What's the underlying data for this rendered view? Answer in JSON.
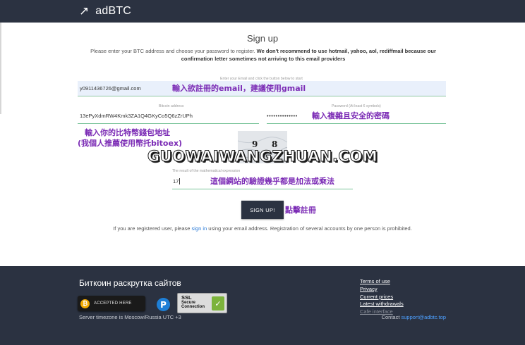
{
  "header": {
    "logo_icon": "arrow-up-right-icon",
    "logo_text": "adBTC",
    "bg_color": "#2b3241"
  },
  "form": {
    "title": "Sign up",
    "intro_normal": "Please enter your BTC address and choose your password to register. ",
    "intro_bold": "We don't recommend to use hotmail, yahoo, aol, rediffmail because our confirmation letter sometimes not arriving to this email providers",
    "email_hint": "Enter your Email and click the button below to start",
    "email_value": "y0911436726@gmail.com",
    "bitcoin_hint": "Bitcoin address",
    "bitcoin_value": "13ePyXdmRW4Kmk3ZA1Q4GKyCo5Q6zZrUPh",
    "password_hint": "Password (At least 6 symbols)",
    "password_value": "••••••••••••••",
    "captcha_digit_1": "9",
    "captcha_digit_2": "8",
    "captcha_hint": "The result of the mathematical expression",
    "captcha_answer": "17",
    "signup_label": "SIGN UP!",
    "registered_before": "If you are registered user, please ",
    "registered_link": "sign in",
    "registered_after": " using your email address. Registration of several accounts by one person is prohibited."
  },
  "annotations": {
    "email_note": "輸入欲註冊的email，建議使用gmail",
    "password_note": "輸入複雜且安全的密碼",
    "btc_note_1": "輸入你的比特幣錢包地址",
    "btc_note_2": "(我個人推薦使用幣托bitoex)",
    "watermark": "GUOWAIWANGZHUAN.COM",
    "captcha_note": "這個網站的驗證幾乎都是加法或乘法",
    "signup_note": "點擊註冊",
    "note_color": "#7b2bb5"
  },
  "footer": {
    "title": "Биткоин раскрутка сайтов",
    "badge_accept": "ACCEPTED HERE",
    "badge_p": "P",
    "ssl_line1": "SSL",
    "ssl_line2": "Secure",
    "ssl_line3": "Connection",
    "links": [
      "Terms of use",
      "Privacy",
      "Current prices",
      "Latest withdrawals",
      "Cafe interface"
    ],
    "timezone": "Server timezone is Moscow/Russia UTC +3",
    "contact_label": "Contact ",
    "contact_email": "support@adbtc.top"
  }
}
